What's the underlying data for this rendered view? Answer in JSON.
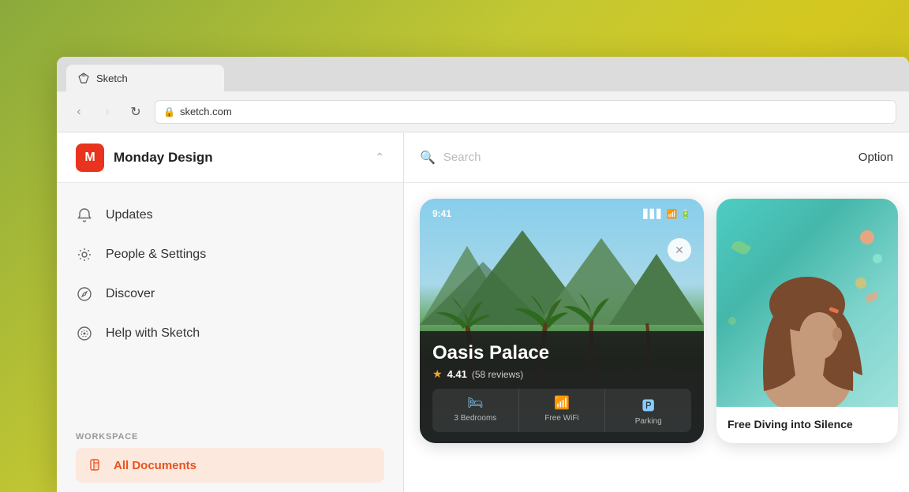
{
  "browser": {
    "tab_title": "Sketch",
    "tab_icon": "◆",
    "address": "sketch.com",
    "back_button": "‹",
    "forward_button": "›",
    "refresh_button": "↻"
  },
  "sidebar": {
    "workspace_name": "Monday Design",
    "workspace_icon": "M",
    "nav_items": [
      {
        "label": "Updates",
        "icon": "bell"
      },
      {
        "label": "People & Settings",
        "icon": "gear"
      },
      {
        "label": "Discover",
        "icon": "compass"
      },
      {
        "label": "Help with Sketch",
        "icon": "help"
      }
    ],
    "workspace_section_title": "WORKSPACE",
    "all_documents_label": "All Documents"
  },
  "search": {
    "placeholder": "Search",
    "options_label": "Option"
  },
  "cards": [
    {
      "type": "hotel",
      "time": "9:41",
      "name": "Oasis Palace",
      "rating": "4.41",
      "reviews": "(58 reviews)",
      "amenities": [
        {
          "label": "3 Bedrooms",
          "icon": "🛏"
        },
        {
          "label": "Free WiFi",
          "icon": "📶"
        },
        {
          "label": "Parking",
          "icon": "🚗"
        }
      ]
    },
    {
      "type": "person",
      "caption": "Free Diving into Silence"
    }
  ]
}
